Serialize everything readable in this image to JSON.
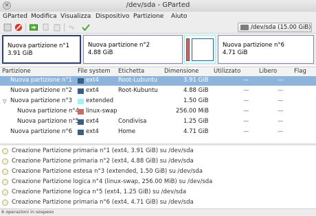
{
  "window": {
    "title": "/dev/sda - GParted"
  },
  "menu": [
    "GParted",
    "Modifica",
    "Visualizza",
    "Dispositivo",
    "Partizione",
    "Aiuto"
  ],
  "toolbar": {
    "device_label": "/dev/sda",
    "device_size": "(15.00 GiB)",
    "icons": [
      "new-icon",
      "delete-icon",
      "resize-move-icon",
      "copy-icon",
      "paste-icon",
      "undo-icon",
      "apply-icon"
    ]
  },
  "map": [
    {
      "name": "Nuova partizione n°1",
      "size": "3.91 GiB"
    },
    {
      "name": "Nuova partizione n°2",
      "size": "4.88 GiB"
    },
    {
      "name": "Nuova partizione n°6",
      "size": "4.71 GiB"
    }
  ],
  "columns": [
    "Partizione",
    "File system",
    "Etichetta",
    "Dimensione",
    "Utilizzato",
    "Libero",
    "Flag"
  ],
  "rows": [
    {
      "partition": "Nuova partizione n°1",
      "fs": "ext4",
      "label": "Root-Lubuntu",
      "size": "3.91 GiB",
      "used": "—",
      "free": "—",
      "color": "#3a5f86",
      "selected": true
    },
    {
      "partition": "Nuova partizione n°2",
      "fs": "ext4",
      "label": "Root-Kubuntu",
      "size": "4.88 GiB",
      "used": "—",
      "free": "—",
      "color": "#3a5f86"
    },
    {
      "partition": "Nuova partizione n°3",
      "fs": "extended",
      "label": "",
      "size": "1.50 GiB",
      "used": "—",
      "free": "—",
      "color": "#9ff3f3"
    },
    {
      "partition": "Nuova partizione n°4",
      "fs": "linux-swap",
      "label": "",
      "size": "256.00 MiB",
      "used": "—",
      "free": "—",
      "color": "#c76a6a"
    },
    {
      "partition": "Nuova partizione n°5",
      "fs": "ext4",
      "label": "Condivisa",
      "size": "1.25 GiB",
      "used": "—",
      "free": "—",
      "color": "#3a5f86"
    },
    {
      "partition": "Nuova partizione n°6",
      "fs": "ext4",
      "label": "Home",
      "size": "4.71 GiB",
      "used": "—",
      "free": "—",
      "color": "#3a5f86"
    }
  ],
  "operations": [
    "Creazione Partizione primaria n°1 (ext4, 3.91 GiB) su /dev/sda",
    "Creazione Partizione primaria n°2 (ext4, 4.88 GiB) su /dev/sda",
    "Creazione Partizione estesa n°3 (extended, 1.50 GiB) su /dev/sda",
    "Creazione Partizione logica n°4 (linux-swap, 256.00 MiB) su /dev/sda",
    "Creazione Partizione logica n°5 (ext4, 1.25 GiB) su /dev/sda",
    "Creazione Partizione primaria n°6 (ext4, 4.71 GiB) su /dev/sda"
  ],
  "status": "6 operazioni in sospeso"
}
